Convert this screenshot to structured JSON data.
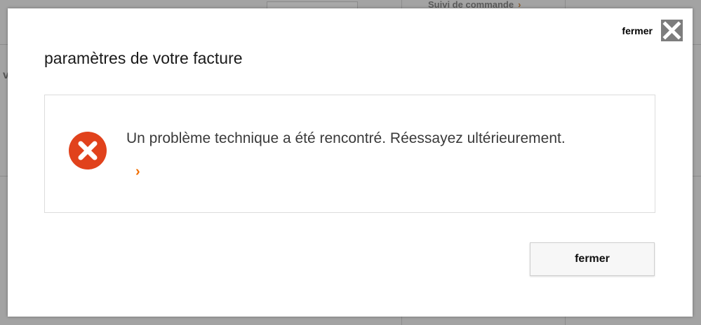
{
  "background": {
    "tracking_link": "Suivi de commande",
    "left_char": "v"
  },
  "modal": {
    "close_top_label": "fermer",
    "close_icon": "close-x-icon",
    "title": "paramètres de votre facture",
    "error": {
      "icon": "error-circle-icon",
      "icon_color": "#e1421c",
      "message": "Un problème technique a été rencontré. Réessayez ultérieurement.",
      "link_chevron": "›",
      "link_color": "#f16e00"
    },
    "close_button_label": "fermer"
  }
}
